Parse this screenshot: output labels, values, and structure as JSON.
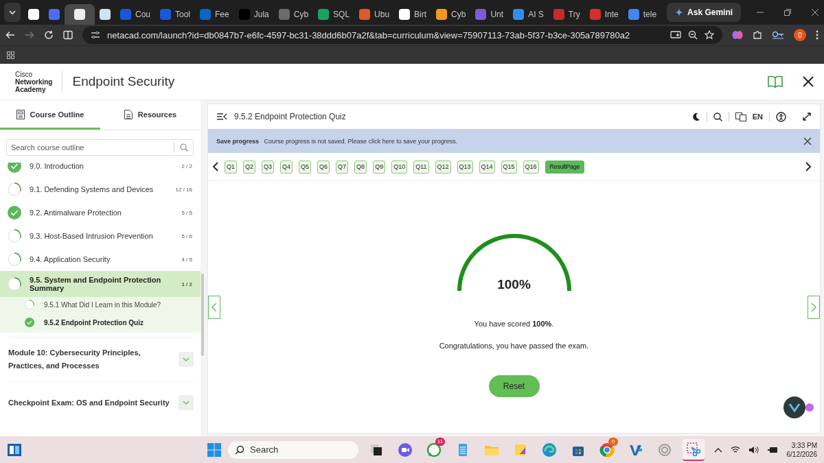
{
  "browser": {
    "tabs": [
      {
        "color": "#ffffff",
        "selected": false
      },
      {
        "color": "#4a6cf7",
        "selected": false
      },
      {
        "color": "#e8eef2",
        "selected": true
      },
      {
        "color": "#cfe3ef",
        "selected": false
      },
      {
        "label": "Cou",
        "color": "#1a56db",
        "selected": false
      },
      {
        "label": "Tool",
        "color": "#1a56db",
        "selected": false
      },
      {
        "label": "Fee",
        "color": "#0a66c2",
        "selected": false
      },
      {
        "label": "Jula",
        "color": "#000000",
        "selected": false
      },
      {
        "label": "Cyb",
        "color": "#6b6b6b",
        "selected": false
      },
      {
        "label": "SQL",
        "color": "#1aa260",
        "selected": false
      },
      {
        "label": "Ubu",
        "color": "#e2572c",
        "selected": false
      },
      {
        "label": "Birt",
        "color": "#ffffff",
        "selected": false
      },
      {
        "label": "Cyb",
        "color": "#f29a1f",
        "selected": false
      },
      {
        "label": "Unt",
        "color": "#7b5cd6",
        "selected": false
      },
      {
        "label": "AI S",
        "color": "#2f8ff0",
        "selected": false
      },
      {
        "label": "Try",
        "color": "#c42b2b",
        "selected": false
      },
      {
        "label": "Inte",
        "color": "#d0312d",
        "selected": false
      },
      {
        "label": "tele",
        "color": "#4285f4",
        "selected": false
      }
    ],
    "gemini": "Ask Gemini",
    "url": "netacad.com/launch?id=db0847b7-e6fc-4597-bc31-38ddd6b07a2f&tab=curriculum&view=75907113-73ab-5f37-b3ce-305a789780a2",
    "profile": "0"
  },
  "header": {
    "brand": [
      "Cisco",
      "Networking",
      "Academy"
    ],
    "title": "Endpoint Security"
  },
  "sidebar": {
    "tabs": [
      {
        "label": "Course Outline",
        "selected": true
      },
      {
        "label": "Resources",
        "selected": false
      }
    ],
    "search": {
      "placeholder": "Search course outline"
    },
    "items": [
      {
        "label": "9.0. Introduction",
        "count": "2 / 2",
        "completed": true,
        "selected": false
      },
      {
        "label": "9.1. Defending Systems and Devices",
        "count": "12 / 16",
        "completed": false,
        "selected": false
      },
      {
        "label": "9.2. Antimalware Protection",
        "count": "5 / 5",
        "completed": true,
        "selected": false
      },
      {
        "label": "9.3. Host-Based Intrusion Prevention",
        "count": "5 / 6",
        "completed": false,
        "selected": false
      },
      {
        "label": "9.4. Application Security",
        "count": "4 / 5",
        "completed": false,
        "selected": false
      },
      {
        "label": "9.5. System and Endpoint Protection Summary",
        "count": "1 / 2",
        "completed": false,
        "selected": true,
        "expanded": true,
        "children": [
          {
            "label": "9.5.1 What Did I Learn in this Module?",
            "completed": false,
            "selected": false
          },
          {
            "label": "9.5.2 Endpoint Protection Quiz",
            "completed": true,
            "selected": true
          }
        ]
      }
    ],
    "modules": [
      {
        "label": "Module 10: Cybersecurity Principles, Practices, and Processes"
      },
      {
        "label": "Checkpoint Exam: OS and Endpoint Security"
      }
    ]
  },
  "main": {
    "title": "9.5.2 Endpoint Protection Quiz",
    "language": "EN",
    "banner": {
      "heading": "Save progress",
      "before": "Course progress is not saved. Please",
      "link": "click here",
      "after": "to save your progress."
    },
    "questions": [
      {
        "label": "Q1",
        "selected": false
      },
      {
        "label": "Q2",
        "selected": false
      },
      {
        "label": "Q3",
        "selected": false
      },
      {
        "label": "Q4",
        "selected": false
      },
      {
        "label": "Q5",
        "selected": false
      },
      {
        "label": "Q6",
        "selected": false
      },
      {
        "label": "Q7",
        "selected": false
      },
      {
        "label": "Q8",
        "selected": false
      },
      {
        "label": "Q9",
        "selected": false
      },
      {
        "label": "Q10",
        "selected": false
      },
      {
        "label": "Q11",
        "selected": false
      },
      {
        "label": "Q12",
        "selected": false
      },
      {
        "label": "Q13",
        "selected": false
      },
      {
        "label": "Q14",
        "selected": false
      },
      {
        "label": "Q15",
        "selected": false
      },
      {
        "label": "Q16",
        "selected": false
      },
      {
        "label": "ResultPage",
        "selected": true
      }
    ],
    "result": {
      "score": "100%",
      "level": 1,
      "message": "You have scored **100%**.",
      "congrats": "Congratulations, you have passed the exam.",
      "reset": "Reset"
    }
  },
  "taskbar": {
    "search": {
      "placeholder": "Search"
    },
    "apps": [
      {
        "kind": "taskview",
        "selected": false
      },
      {
        "kind": "meet",
        "selected": false
      },
      {
        "kind": "chat",
        "badge": "11",
        "selected": false
      },
      {
        "kind": "notepad",
        "selected": false
      },
      {
        "kind": "folder",
        "selected": false
      },
      {
        "kind": "notes",
        "selected": false
      },
      {
        "kind": "edge",
        "selected": false
      },
      {
        "kind": "store",
        "selected": false
      },
      {
        "kind": "chrome",
        "badge": "0",
        "selected": false
      },
      {
        "kind": "vs",
        "selected": false
      },
      {
        "kind": "ring",
        "selected": false
      },
      {
        "kind": "snip",
        "selected": true
      }
    ],
    "time": "3:33 PM",
    "date": "6/12/2026"
  }
}
